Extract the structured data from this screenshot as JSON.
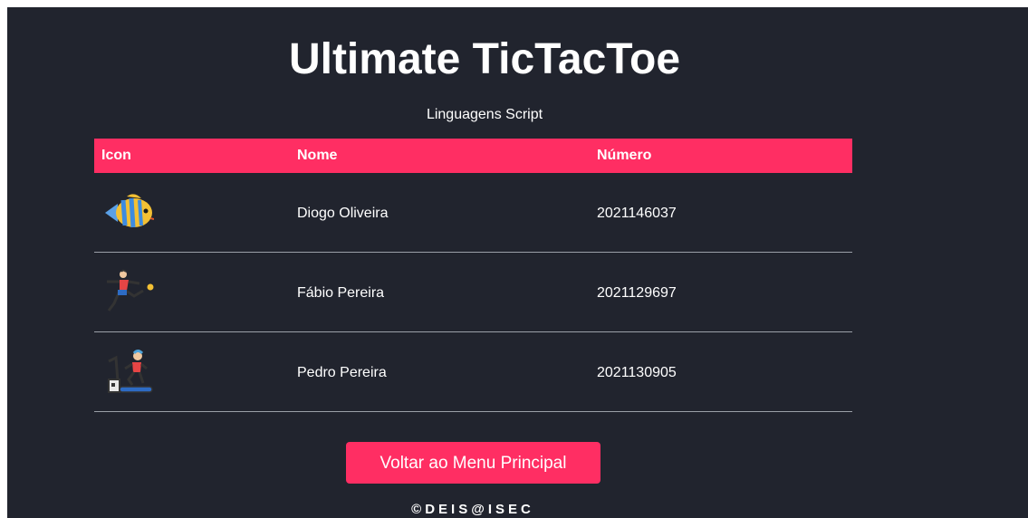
{
  "page": {
    "title": "Ultimate TicTacToe",
    "subtitle": "Linguagens Script"
  },
  "table": {
    "headers": [
      "Icon",
      "Nome",
      "Número"
    ],
    "rows": [
      {
        "icon": "tropical-fish-icon",
        "nome": "Diogo Oliveira",
        "numero": "2021146037"
      },
      {
        "icon": "soccer-player-icon",
        "nome": "Fábio Pereira",
        "numero": "2021129697"
      },
      {
        "icon": "treadmill-runner-icon",
        "nome": "Pedro Pereira",
        "numero": "2021130905"
      }
    ]
  },
  "actions": {
    "back_label": "Voltar ao Menu Principal"
  },
  "footer": {
    "text": "©DEIS@ISEC"
  },
  "colors": {
    "background": "#21242e",
    "accent": "#ff2e63",
    "text": "#ffffff",
    "divider": "#9ba0a8"
  }
}
